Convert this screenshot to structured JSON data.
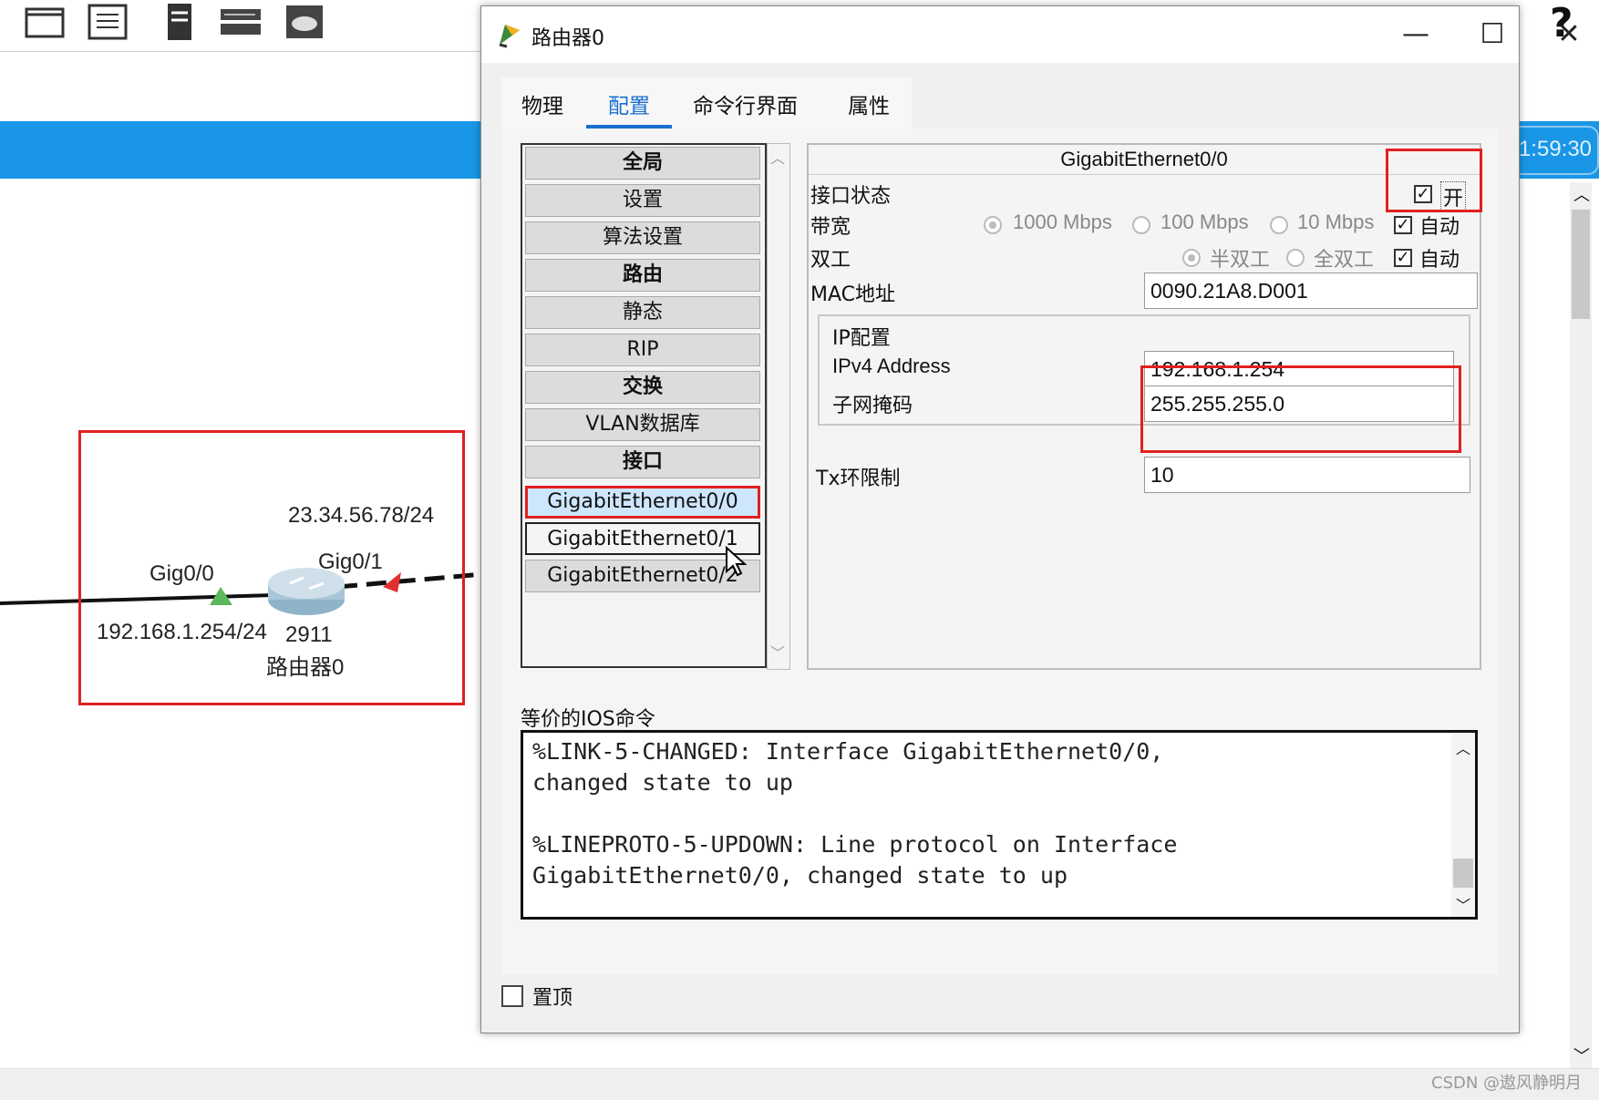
{
  "workspace": {
    "time_display": "1:59:30",
    "help_label": "?",
    "topology": {
      "label_public_ip": "23.34.56.78/24",
      "label_left_port": "Gig0/0",
      "label_right_port": "Gig0/1",
      "label_lan_ip": "192.168.1.254/24",
      "label_model": "2911",
      "label_device_name": "路由器0"
    }
  },
  "dialog": {
    "title": "路由器0",
    "controls": {
      "minimize": "—",
      "maximize": "☐",
      "close": "✕"
    },
    "tabs": [
      {
        "label": "物理",
        "active": false
      },
      {
        "label": "配置",
        "active": true
      },
      {
        "label": "命令行界面",
        "active": false
      },
      {
        "label": "属性",
        "active": false
      }
    ],
    "nav": {
      "items": [
        {
          "label": "全局",
          "bold": true
        },
        {
          "label": "设置",
          "bold": false
        },
        {
          "label": "算法设置",
          "bold": false
        },
        {
          "label": "路由",
          "bold": true
        },
        {
          "label": "静态",
          "bold": false
        },
        {
          "label": "RIP",
          "bold": false
        },
        {
          "label": "交换",
          "bold": true
        },
        {
          "label": "VLAN数据库",
          "bold": false
        },
        {
          "label": "接口",
          "bold": true
        },
        {
          "label": "GigabitEthernet0/0",
          "bold": false,
          "selected": true
        },
        {
          "label": "GigabitEthernet0/1",
          "bold": false
        },
        {
          "label": "GigabitEthernet0/2",
          "bold": false
        }
      ]
    },
    "interface": {
      "name": "GigabitEthernet0/0",
      "port_status_label": "接口状态",
      "port_on_label": "开",
      "port_on_checked": true,
      "bandwidth_label": "带宽",
      "bandwidth_options": [
        "1000 Mbps",
        "100 Mbps",
        "10 Mbps"
      ],
      "bandwidth_auto_label": "自动",
      "duplex_label": "双工",
      "duplex_options": [
        "半双工",
        "全双工"
      ],
      "duplex_auto_label": "自动",
      "mac_label": "MAC地址",
      "mac_value": "0090.21A8.D001",
      "ip_config_label": "IP配置",
      "ipv4_label": "IPv4 Address",
      "ipv4_value": "192.168.1.254",
      "mask_label": "子网掩码",
      "mask_value": "255.255.255.0",
      "tx_label": "Tx环限制",
      "tx_value": "10"
    },
    "ios_label": "等价的IOS命令",
    "ios_output": "%LINK-5-CHANGED: Interface GigabitEthernet0/0,\nchanged state to up\n\n%LINEPROTO-5-UPDOWN: Line protocol on Interface\nGigabitEthernet0/0, changed state to up",
    "always_on_top_label": "置顶"
  },
  "watermark": "CSDN @遨风静明月"
}
